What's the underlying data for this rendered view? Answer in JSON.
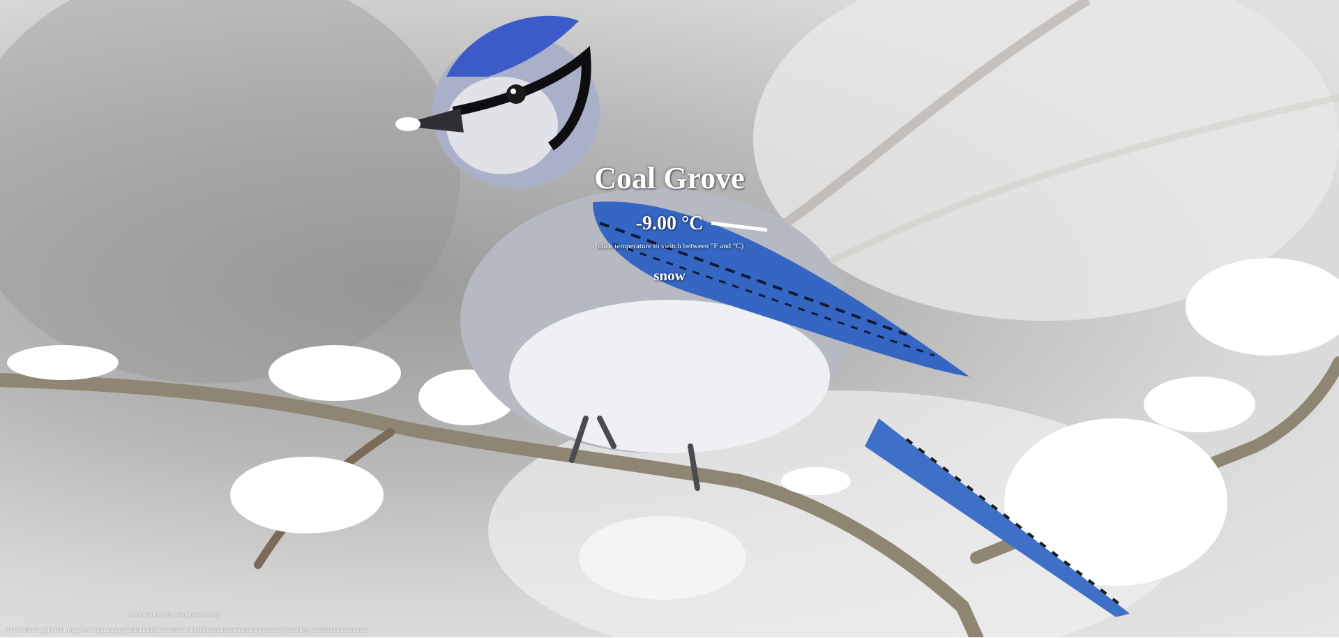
{
  "weather": {
    "city": "Coal Grove",
    "temperature": "-9.00 °C",
    "hint": "(click temperature to switch between °F and °C)",
    "condition": "snow"
  },
  "credit": {
    "line1": "Andrew thutler 2017, background credit:",
    "line2": "By DM Blue Jay(s) (GFDL (http://www.gnu.org/copyleft/fdl.html) or CC-BY-SA-3.0 (http://creativecommons.org/licenses/by-sa/3.0/)), via Wikimedia Commons"
  },
  "background": {
    "subject": "blue jay on snowy branch",
    "sky_color": "#d8d8d8",
    "bird_blue": "#3d6fd1"
  }
}
